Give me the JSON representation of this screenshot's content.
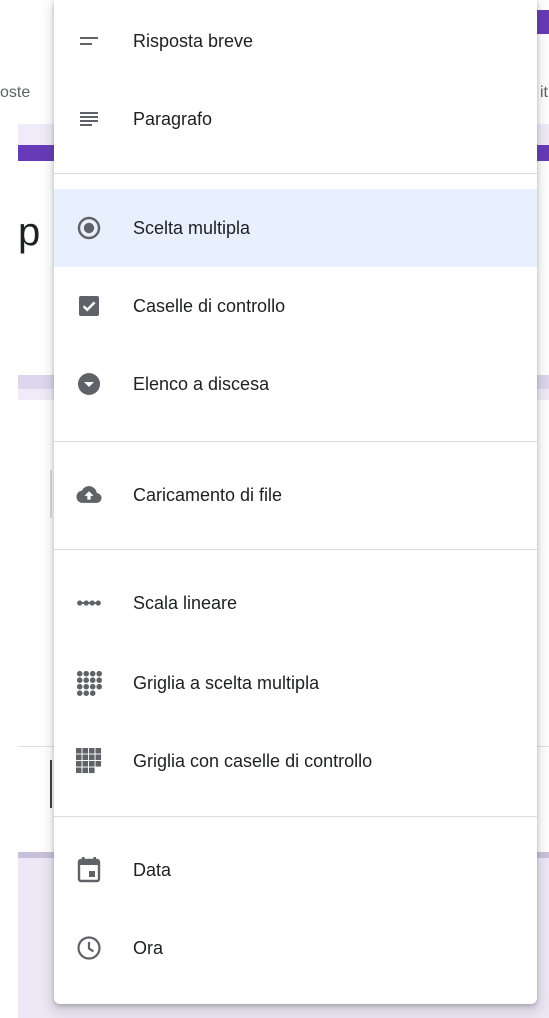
{
  "background": {
    "tab_left_fragment": "oste",
    "tab_right_fragment": "it",
    "title_fragment": "p"
  },
  "colors": {
    "accent": "#673ab7",
    "selected_bg": "#e8f0fe",
    "icon": "#5f6368"
  },
  "menu": {
    "items": [
      {
        "label": "Risposta breve",
        "icon": "short-answer-icon"
      },
      {
        "label": "Paragrafo",
        "icon": "paragraph-icon"
      },
      {
        "label": "Scelta multipla",
        "icon": "radio-button-icon",
        "selected": true
      },
      {
        "label": "Caselle di controllo",
        "icon": "checkbox-icon"
      },
      {
        "label": "Elenco a discesa",
        "icon": "dropdown-circle-icon"
      },
      {
        "label": "Caricamento di file",
        "icon": "cloud-upload-icon"
      },
      {
        "label": "Scala lineare",
        "icon": "linear-scale-icon"
      },
      {
        "label": "Griglia a scelta multipla",
        "icon": "dot-grid-icon"
      },
      {
        "label": "Griglia con caselle di controllo",
        "icon": "square-grid-icon"
      },
      {
        "label": "Data",
        "icon": "calendar-icon"
      },
      {
        "label": "Ora",
        "icon": "clock-icon"
      }
    ]
  }
}
